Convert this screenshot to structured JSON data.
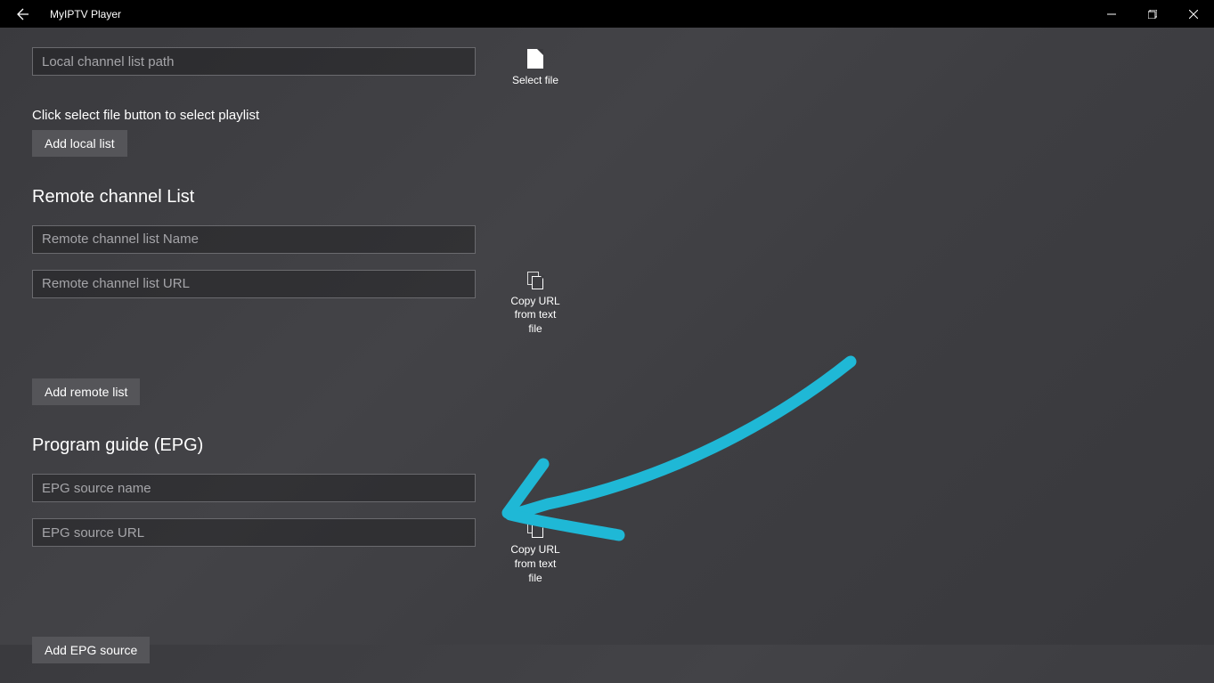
{
  "titlebar": {
    "app_title": "MyIPTV Player"
  },
  "local": {
    "path_placeholder": "Local channel list path",
    "select_file_label": "Select file",
    "helper_text": "Click select file button to select playlist",
    "add_button": "Add local list"
  },
  "remote": {
    "heading": "Remote channel List",
    "name_placeholder": "Remote channel list Name",
    "url_placeholder": "Remote channel list URL",
    "copy_label_line1": "Copy URL",
    "copy_label_line2": "from text",
    "copy_label_line3": "file",
    "add_button": "Add remote list"
  },
  "epg": {
    "heading": "Program guide (EPG)",
    "name_placeholder": "EPG source name",
    "url_placeholder": "EPG source URL",
    "copy_label_line1": "Copy URL",
    "copy_label_line2": "from text",
    "copy_label_line3": "file",
    "add_button": "Add EPG source"
  }
}
